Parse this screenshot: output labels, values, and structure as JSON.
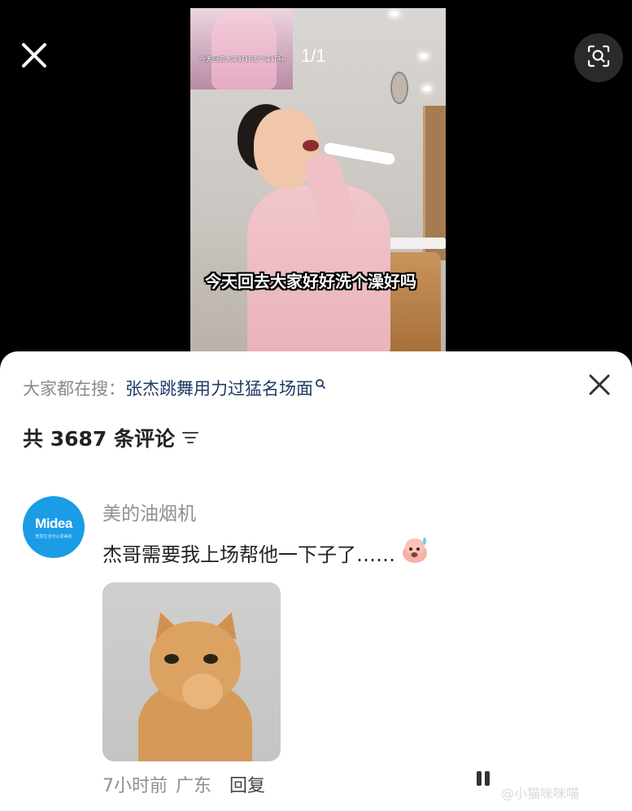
{
  "viewer": {
    "close_icon": "close-icon",
    "lens_icon": "image-search-icon",
    "page_indicator": "1/1",
    "video_caption": "今天回去大家好好洗个澡好吗",
    "inset_caption": "今天回去大家好好洗个澡好吗"
  },
  "sheet": {
    "search_prefix": "大家都在搜：",
    "search_query": "张杰跳舞用力过猛名场面",
    "search_icon": "search-icon",
    "close_icon": "close-icon",
    "comment_count_label": "共 3687 条评论",
    "filter_icon": "sort-filter-icon"
  },
  "comment": {
    "avatar_brand": "Midea",
    "avatar_tagline": "智慧生活可以更美的",
    "username": "美的油烟机",
    "text": "杰哥需要我上场帮他一下子了……",
    "emoji": "sweat-face-emoji",
    "time": "7小时前",
    "location": "广东",
    "reply_label": "回复"
  },
  "watermark": "@小猫咪咪喵"
}
